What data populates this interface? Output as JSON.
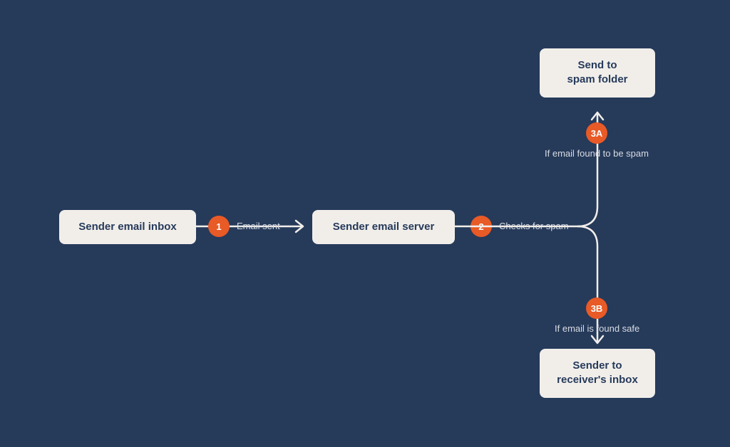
{
  "nodes": {
    "sender_inbox": "Sender email inbox",
    "sender_server": "Sender email server",
    "spam_folder_line1": "Send to",
    "spam_folder_line2": "spam folder",
    "receiver_inbox_line1": "Sender to",
    "receiver_inbox_line2": "receiver's inbox"
  },
  "steps": {
    "one": {
      "num": "1",
      "label": "Email sent"
    },
    "two": {
      "num": "2",
      "label": "Checks for spam"
    },
    "three_a": {
      "num": "3A",
      "label": "If email found to be spam"
    },
    "three_b": {
      "num": "3B",
      "label": "If email is found safe"
    }
  },
  "colors": {
    "bg": "#263a5a",
    "node_bg": "#f1eeea",
    "node_text": "#263a5a",
    "accent": "#e85a26",
    "line": "#f1eeea",
    "label": "#d8dce3"
  }
}
